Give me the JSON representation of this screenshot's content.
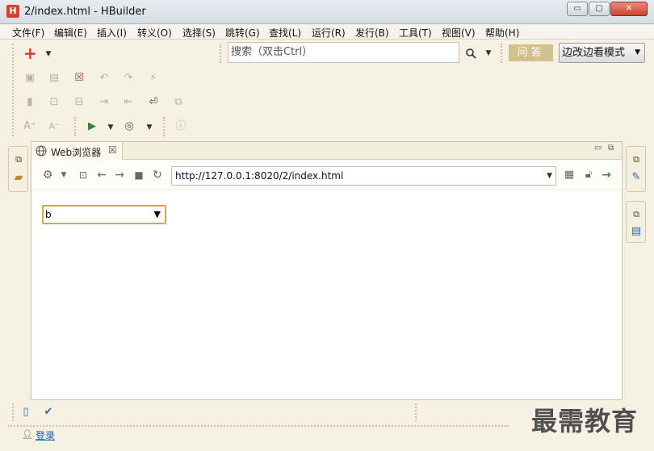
{
  "window": {
    "logo": "H",
    "title": "2/index.html  -  HBuilder",
    "minimize": "▭",
    "maximize": "▢",
    "close": "✕"
  },
  "menu": [
    "文件(F)",
    "编辑(E)",
    "插入(I)",
    "转义(O)",
    "选择(S)",
    "跳转(G)",
    "查找(L)",
    "运行(R)",
    "发行(B)",
    "工具(T)",
    "视图(V)",
    "帮助(H)"
  ],
  "toolbar": {
    "search_placeholder": "搜索（双击Ctrl）",
    "ask_label": "问答",
    "mode_label": "边改边看模式",
    "font_increase": "A⁺",
    "font_decrease": "A⁻"
  },
  "editor": {
    "tab_label": "Web浏览器",
    "tab_close": "☒",
    "url": "http://127.0.0.1:8020/2/index.html"
  },
  "page": {
    "select_value": "b"
  },
  "bottom": {
    "login_label": "登录",
    "watermark": "最需教育"
  },
  "colors": {
    "accent_red": "#d9342b",
    "ask_button": "#d2c08f",
    "background": "#f5f0e1",
    "link": "#1a5fb4"
  }
}
